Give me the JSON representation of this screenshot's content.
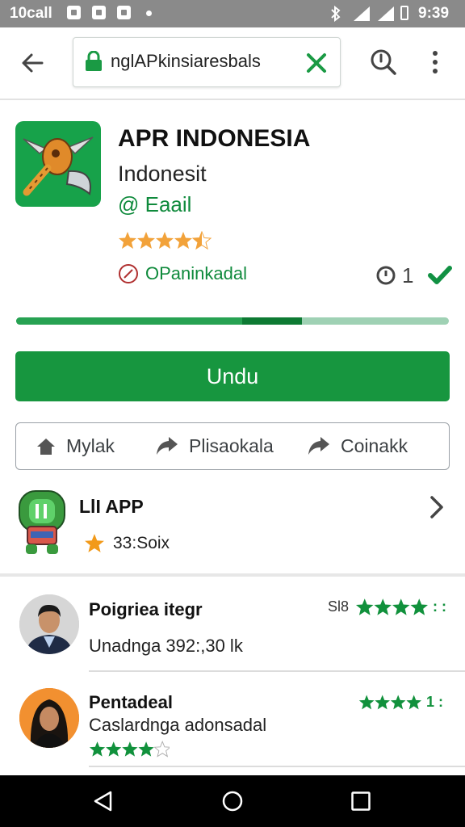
{
  "status_bar": {
    "left_text": "10call",
    "time": "9:39"
  },
  "browser": {
    "url": "nglAPkinsiaresbals"
  },
  "app": {
    "title": "APR INDONESIA",
    "subtitle": "Indonesit",
    "developer": "@ Eaail",
    "rating": 4.5,
    "compat_text": "OPaninkadal",
    "meta_count": "1",
    "progress": 0.66
  },
  "install_label": "Undu",
  "actions": [
    {
      "label": "Mylak",
      "icon": "home-icon"
    },
    {
      "label": "Plisaokala",
      "icon": "share-icon"
    },
    {
      "label": "Coinakk",
      "icon": "share-icon"
    }
  ],
  "related": {
    "title": "LlI APP",
    "sub": "33:Soix"
  },
  "reviews": [
    {
      "name": "Poigriea itegr",
      "text": "Unadnga 392:,30 lk",
      "right_label": "Sl8",
      "stars_right": 4,
      "stars_bottom": null,
      "extra": ": :"
    },
    {
      "name": "Pentadeal",
      "text": "Caslardnga adonsadal",
      "right_label": "",
      "stars_right": 4,
      "stars_bottom": 4,
      "extra": "1 :"
    }
  ],
  "colors": {
    "accent": "#17963f",
    "text": "#202124",
    "star": "#f2a23a",
    "star_green": "#11913c"
  }
}
